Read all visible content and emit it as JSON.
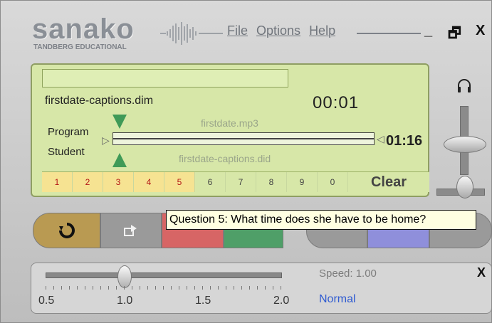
{
  "brand": {
    "logo": "sanako",
    "company": "TANDBERG",
    "division": "EDUCATIONAL"
  },
  "menu": {
    "file": "File",
    "options": "Options",
    "help": "Help"
  },
  "window": {
    "minimize": "_",
    "restore": "🗗",
    "close": "X"
  },
  "player": {
    "filename": "firstdate-captions.dim",
    "current_time": "00:01",
    "program_label": "Program",
    "student_label": "Student",
    "program_track": "firstdate.mp3",
    "student_track": "firstdate-captions.did",
    "total_time": "01:16"
  },
  "bookmarks": {
    "items": [
      "1",
      "2",
      "3",
      "4",
      "5",
      "6",
      "7",
      "8",
      "9",
      "0"
    ],
    "active_count": 5,
    "clear": "Clear"
  },
  "tooltip": "Question 5: What time does she have to be home?",
  "speed": {
    "label": "Speed: 1.00",
    "mode": "Normal",
    "value": 1.0,
    "min": 0.5,
    "max": 2.0,
    "ticks": [
      "0.5",
      "1.0",
      "1.5",
      "2.0"
    ],
    "close": "X"
  },
  "colors": {
    "lcd": "#d7e7a8",
    "track_marker": "#3f9a57",
    "bookmark_active": "#f6e392",
    "bookmark_number": "#b31515",
    "speed_mode": "#2f5bd1"
  },
  "icons": {
    "repeat": "repeat-icon",
    "export": "export-icon",
    "headphone": "headphone-icon"
  }
}
